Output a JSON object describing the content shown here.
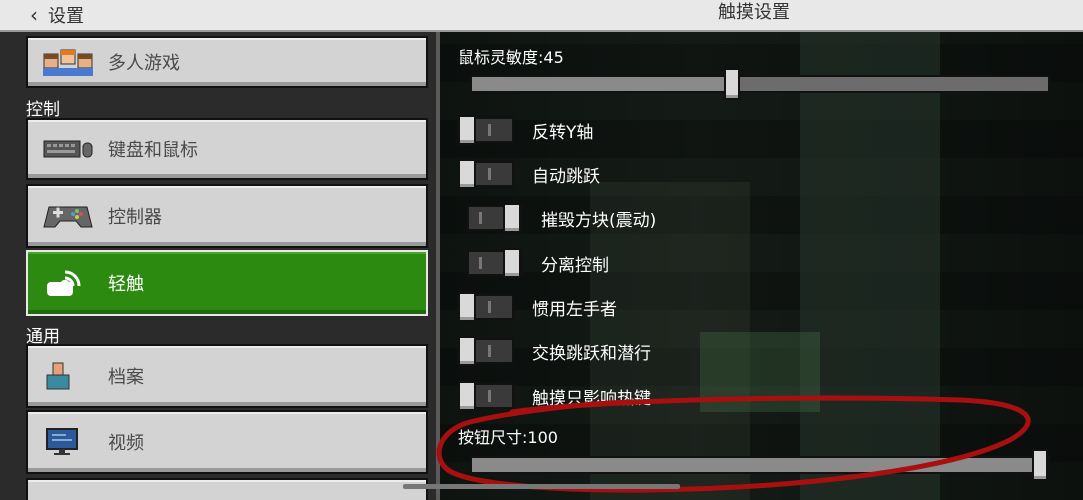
{
  "header": {
    "back_label": "设置",
    "title": "触摸设置"
  },
  "sidebar": {
    "items_top": [
      {
        "label": "多人游戏",
        "icon": "multiplayer-icon"
      }
    ],
    "section_control": "控制",
    "control_items": [
      {
        "label": "键盘和鼠标",
        "icon": "keyboard-mouse-icon"
      },
      {
        "label": "控制器",
        "icon": "gamepad-icon"
      },
      {
        "label": "轻触",
        "icon": "touch-icon",
        "selected": true
      }
    ],
    "section_general": "通用",
    "general_items": [
      {
        "label": "档案",
        "icon": "profile-icon"
      },
      {
        "label": "视频",
        "icon": "monitor-icon"
      }
    ]
  },
  "settings": {
    "mouse_sensitivity": {
      "label": "鼠标灵敏度:45",
      "value": 45,
      "max": 100
    },
    "toggles": [
      {
        "label": "反转Y轴",
        "on": false
      },
      {
        "label": "自动跳跃",
        "on": false
      },
      {
        "label": "摧毁方块(震动)",
        "on": true
      },
      {
        "label": "分离控制",
        "on": true
      },
      {
        "label": "惯用左手者",
        "on": false
      },
      {
        "label": "交换跳跃和潜行",
        "on": false
      },
      {
        "label": "触摸只影响热键",
        "on": false
      }
    ],
    "button_size": {
      "label": "按钮尺寸:100",
      "value": 100,
      "max": 100
    }
  },
  "colors": {
    "selected_green": "#2c8a10",
    "annotation_red": "#b01212"
  }
}
